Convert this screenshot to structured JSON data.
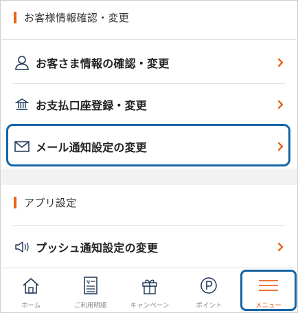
{
  "sections": [
    {
      "title": "お客様情報確認・変更"
    },
    {
      "title": "アプリ設定"
    }
  ],
  "rows": [
    {
      "label": "お客さま情報の確認・変更",
      "icon": "person-icon"
    },
    {
      "label": "お支払口座登録・変更",
      "icon": "bank-icon"
    },
    {
      "label": "メール通知設定の変更",
      "icon": "mail-icon"
    },
    {
      "label": "プッシュ通知設定の変更",
      "icon": "speaker-icon"
    }
  ],
  "tabs": [
    {
      "label": "ホーム",
      "icon": "home-icon"
    },
    {
      "label": "ご利用明細",
      "icon": "statement-icon"
    },
    {
      "label": "キャンペーン",
      "icon": "gift-icon"
    },
    {
      "label": "ポイント",
      "icon": "point-icon"
    },
    {
      "label": "メニュー",
      "icon": "menu-icon"
    }
  ],
  "colors": {
    "accent": "#e8641b",
    "highlight": "#1463a5",
    "muted": "#8a8a8a"
  }
}
